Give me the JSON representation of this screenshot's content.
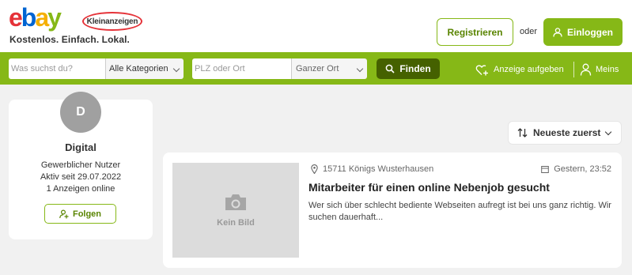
{
  "header": {
    "logo_text": "ebay",
    "logo_badge": "Kleinanzeigen",
    "tagline": "Kostenlos. Einfach. Lokal.",
    "register_label": "Registrieren",
    "or_label": "oder",
    "login_label": "Einloggen"
  },
  "search": {
    "query_placeholder": "Was suchst du?",
    "category_value": "Alle Kategorien",
    "location_placeholder": "PLZ oder Ort",
    "radius_value": "Ganzer Ort",
    "find_label": "Finden",
    "post_ad_label": "Anzeige aufgeben",
    "mine_label": "Meins"
  },
  "profile": {
    "avatar_initial": "D",
    "name": "Digital",
    "type": "Gewerblicher Nutzer",
    "active_since": "Aktiv seit 29.07.2022",
    "ads_online": "1 Anzeigen online",
    "follow_label": "Folgen"
  },
  "sort": {
    "label": "Neueste zuerst"
  },
  "listings": [
    {
      "no_image_label": "Kein Bild",
      "location": "15711 Königs Wusterhausen",
      "date": "Gestern, 23:52",
      "title": "Mitarbeiter für einen online Nebenjob gesucht",
      "description": "Wer sich über schlecht bediente Webseiten aufregt ist bei uns ganz richtig. Wir suchen dauerhaft..."
    }
  ],
  "colors": {
    "brand_green": "#86b817",
    "dark_green": "#456100"
  }
}
